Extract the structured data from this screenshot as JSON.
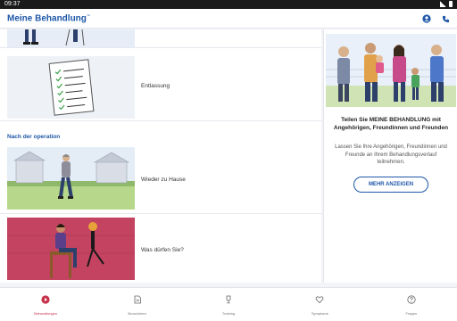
{
  "status_bar": {
    "time": "09:37"
  },
  "app": {
    "title": "Meine Behandlung",
    "trademark": "™"
  },
  "list": {
    "rows": [
      {
        "label": ""
      },
      {
        "label": "Entlassung"
      },
      {
        "label": "Wieder zu Hause"
      },
      {
        "label": "Was dürfen Sie?"
      }
    ],
    "section_title": "Nach der operation"
  },
  "promo": {
    "title": "Teilen Sie MEINE BEHANDLUNG mit Angehörigen, Freundinnen und Freunden",
    "text": "Lassen Sie Ihre Angehörigen, Freundinnen und Freunde an Ihrem Behandlungsverlauf teilnehmen.",
    "button": "MEHR ANZEIGEN"
  },
  "bottom_nav": {
    "items": [
      {
        "label": "Behandlungen",
        "icon": "play-circle-icon",
        "active": true
      },
      {
        "label": "Broschüren",
        "icon": "document-icon",
        "active": false
      },
      {
        "label": "Training",
        "icon": "trophy-icon",
        "active": false
      },
      {
        "label": "Symptome",
        "icon": "heart-icon",
        "active": false
      },
      {
        "label": "Fragen",
        "icon": "question-icon",
        "active": false
      }
    ]
  },
  "colors": {
    "brand": "#1e57a8",
    "accent": "#c8314a"
  }
}
